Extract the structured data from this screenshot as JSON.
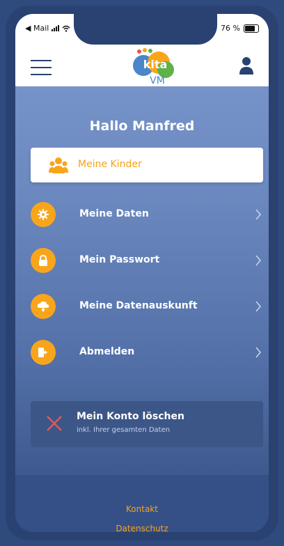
{
  "status_bar": {
    "carrier": "◀ Mail",
    "battery_percent": "76 %"
  },
  "header": {
    "logo_text_top": "kita",
    "logo_text_bottom": "VM"
  },
  "greeting": "Hallo Manfred",
  "kinder_card": {
    "label": "Meine Kinder"
  },
  "menu": [
    {
      "label": "Meine Daten",
      "icon": "gear-icon"
    },
    {
      "label": "Mein Passwort",
      "icon": "lock-icon"
    },
    {
      "label": "Meine Datenauskunft",
      "icon": "cloud-download-icon"
    },
    {
      "label": "Abmelden",
      "icon": "logout-icon"
    }
  ],
  "delete_account": {
    "title": "Mein Konto löschen",
    "subtitle": "inkl. Ihrer gesamten Daten"
  },
  "footer": {
    "contact": "Kontakt",
    "privacy": "Datenschutz"
  },
  "colors": {
    "accent": "#f9a51c",
    "frame": "#2a4272",
    "danger": "#e05a5a"
  }
}
